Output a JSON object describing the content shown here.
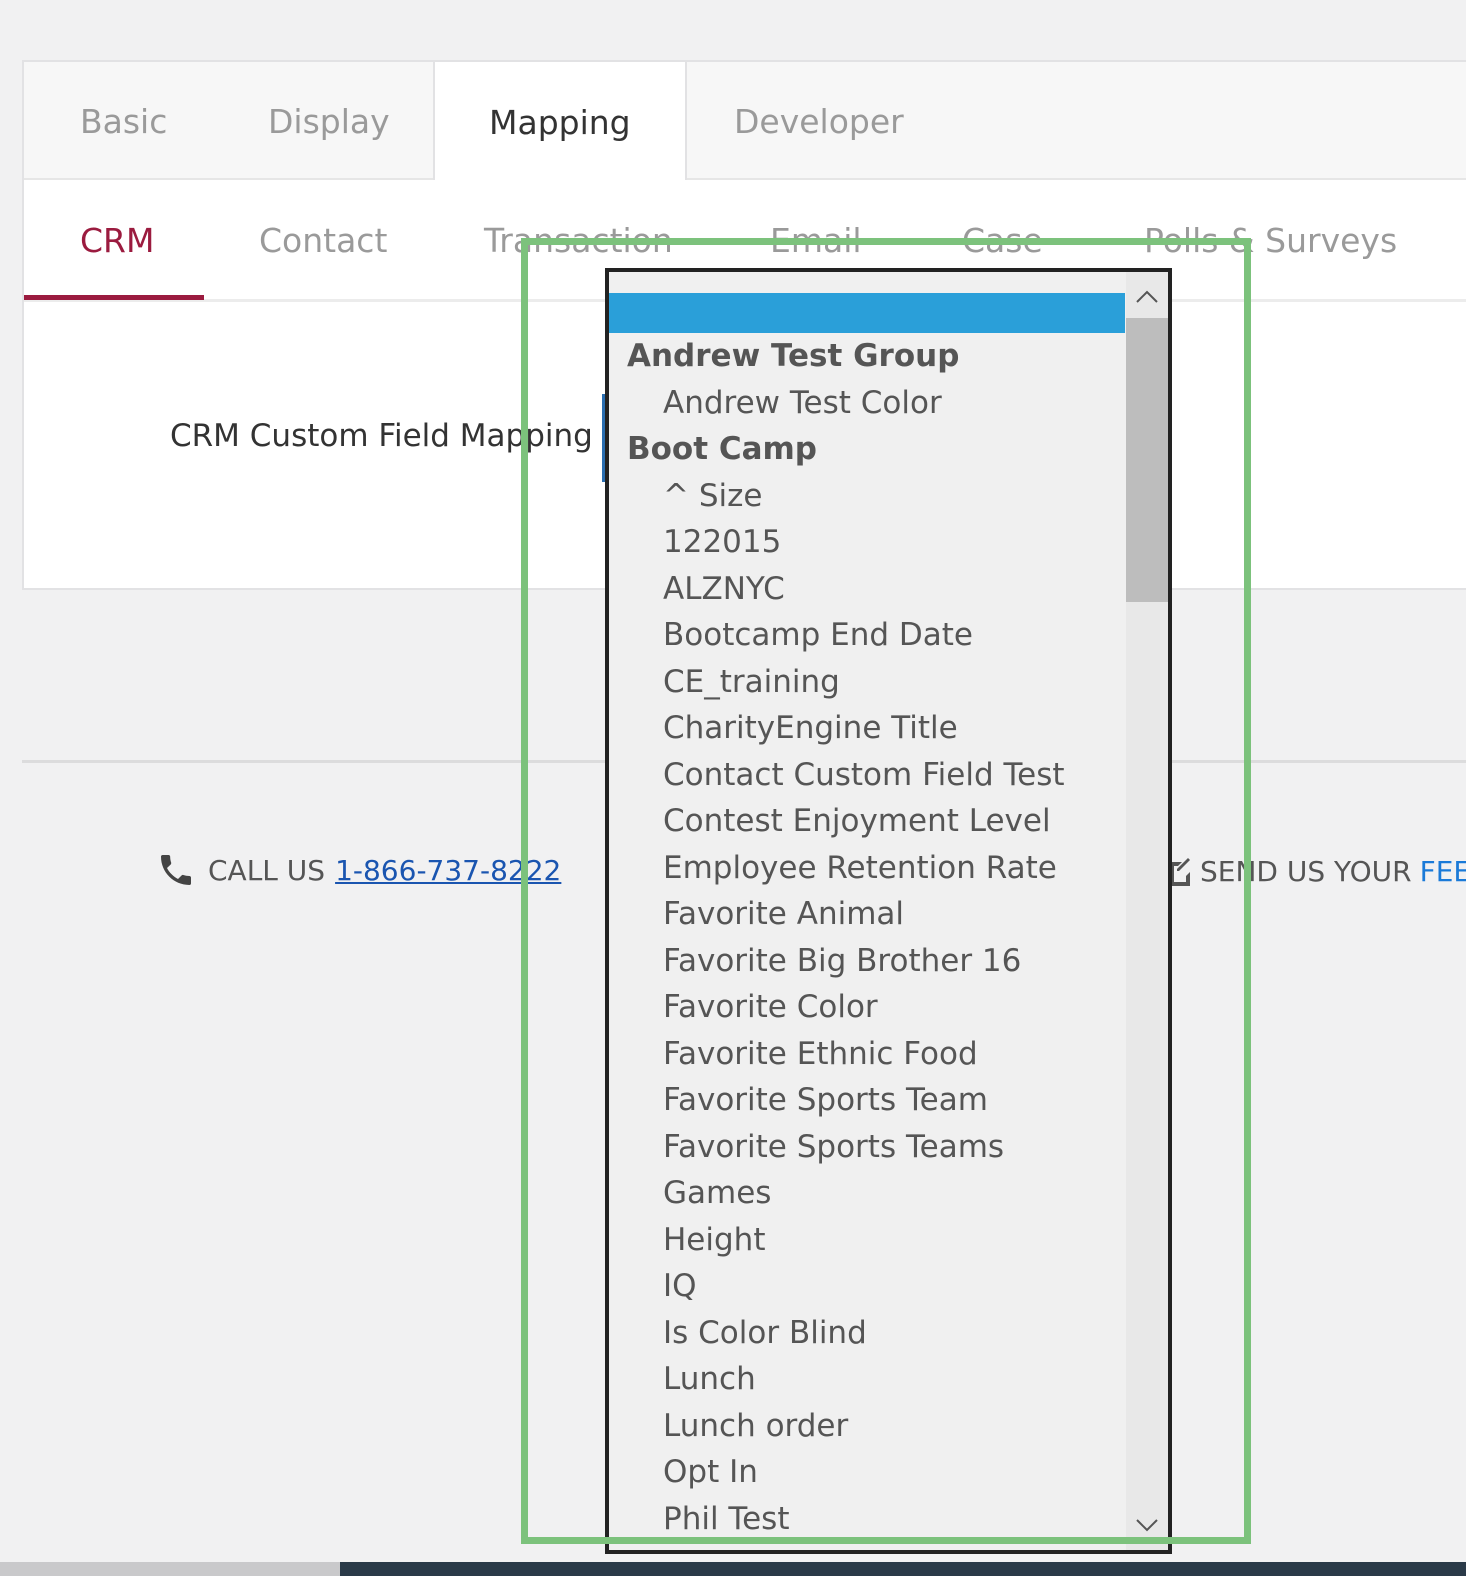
{
  "tabs": [
    "Basic",
    "Display",
    "Mapping",
    "Developer"
  ],
  "subtabs": [
    "CRM",
    "Contact",
    "Transaction",
    "Email",
    "Case",
    "Polls & Surveys"
  ],
  "field": {
    "label": "CRM Custom Field Mapping"
  },
  "dropdown": {
    "options": [
      {
        "label": "",
        "type": "selected"
      },
      {
        "label": "Andrew Test Group",
        "type": "group"
      },
      {
        "label": "Andrew Test Color",
        "type": "item"
      },
      {
        "label": "Boot Camp",
        "type": "group"
      },
      {
        "label": "^ Size",
        "type": "item"
      },
      {
        "label": "122015",
        "type": "item"
      },
      {
        "label": "ALZNYC",
        "type": "item"
      },
      {
        "label": "Bootcamp End Date",
        "type": "item"
      },
      {
        "label": "CE_training",
        "type": "item"
      },
      {
        "label": "CharityEngine Title",
        "type": "item"
      },
      {
        "label": "Contact Custom Field Test",
        "type": "item"
      },
      {
        "label": "Contest Enjoyment Level",
        "type": "item"
      },
      {
        "label": "Employee Retention Rate",
        "type": "item"
      },
      {
        "label": "Favorite Animal",
        "type": "item"
      },
      {
        "label": "Favorite Big Brother 16",
        "type": "item"
      },
      {
        "label": "Favorite Color",
        "type": "item"
      },
      {
        "label": "Favorite Ethnic Food",
        "type": "item"
      },
      {
        "label": "Favorite Sports Team",
        "type": "item"
      },
      {
        "label": "Favorite Sports Teams",
        "type": "item"
      },
      {
        "label": "Games",
        "type": "item"
      },
      {
        "label": "Height",
        "type": "item"
      },
      {
        "label": "IQ",
        "type": "item"
      },
      {
        "label": "Is Color Blind",
        "type": "item"
      },
      {
        "label": "Lunch",
        "type": "item"
      },
      {
        "label": "Lunch order",
        "type": "item"
      },
      {
        "label": "Opt In",
        "type": "item"
      },
      {
        "label": "Phil Test",
        "type": "item"
      }
    ]
  },
  "footer": {
    "call_label": "CALL US",
    "phone": "1-866-737-8222",
    "send_label": "SEND US YOUR",
    "feedback_fragment": "FEE"
  },
  "colors": {
    "accent_crm": "#9b1b3f",
    "selected_option": "#2a9fd9",
    "highlight_border": "#7cc27c",
    "link": "#1a55b0"
  }
}
